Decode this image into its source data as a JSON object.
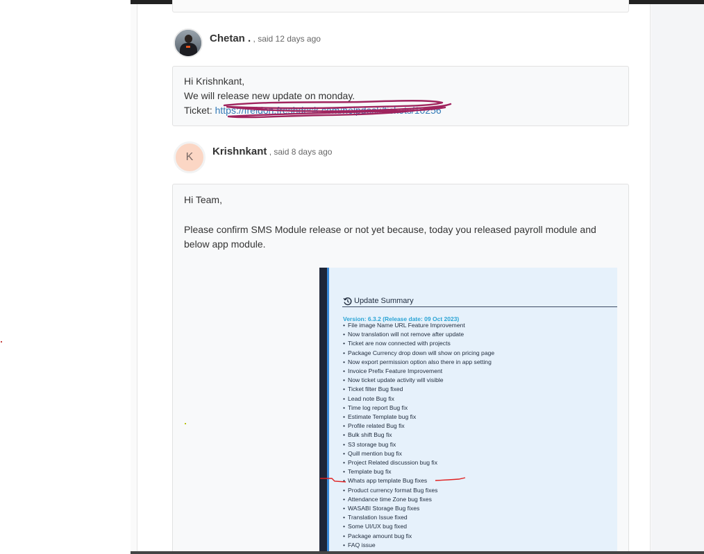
{
  "thread": {
    "comments": [
      {
        "author": "Chetan .",
        "meta": ", said 12 days ago",
        "lines": [
          "Hi Krishnkant,",
          "We will release new update on monday."
        ],
        "ticket_label": "Ticket: ",
        "ticket_link": "https://freidon.freshdesk.com/helpdesk/tickets/10256"
      },
      {
        "author": "Krishnkant",
        "avatar_letter": "K",
        "meta": ", said 8 days ago",
        "greeting": "Hi Team,",
        "body": "Please confirm SMS Module release or not yet because, today you released payroll module and below app module."
      }
    ]
  },
  "attachment": {
    "title": "Update Summary",
    "version": "Version: 6.3.2 (Release date: 09 Oct 2023)",
    "items": [
      "File image Name URL Feature Improvement",
      "Now translation will not remove after update",
      "Ticket are now connected with projects",
      "Package Currency drop down will show on pricing page",
      "Now export permission option also there in app setting",
      "Invoice Prefix Feature Improvement",
      "Now ticket update activity will visible",
      "Ticket filter Bug fixed",
      "Lead note Bug fix",
      "Time log report Bug fix",
      "Estimate Template bug fix",
      "Profile related Bug fix",
      "Bulk shift Bug fix",
      "S3 storage bug fix",
      "Quill mention bug fix",
      "Project Related discussion bug fix",
      "Template bug fix",
      "Whats app template Bug fixes",
      "Product currency format Bug fixes",
      "Attendance time Zone bug fixes",
      "WASABI Storage Bug fixes",
      "Translation Issue fixed",
      "Some UI/UX bug fixed",
      "Package amount bug fix",
      "FAQ issue"
    ]
  },
  "colors": {
    "link": "#337ab7",
    "scribble": "#a0245e",
    "red_mark": "#e02020",
    "avatar_letter_bg": "#fbd6c4",
    "version_text": "#2aa4d5"
  }
}
